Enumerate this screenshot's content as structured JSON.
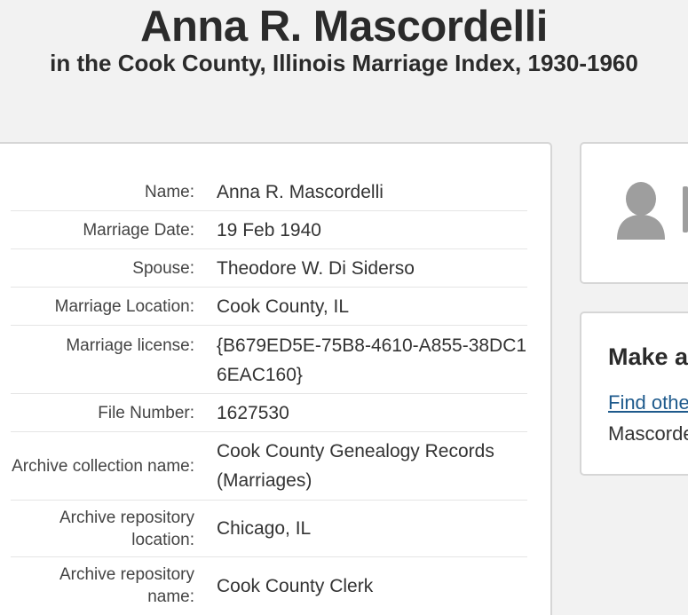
{
  "header": {
    "title": "Anna R. Mascordelli",
    "subtitle": "in the Cook County, Illinois Marriage Index, 1930-1960"
  },
  "record": {
    "rows": [
      {
        "label": "Name:",
        "value": "Anna R. Mascordelli"
      },
      {
        "label": "Marriage Date:",
        "value": "19 Feb 1940"
      },
      {
        "label": "Spouse:",
        "value": "Theodore W. Di Siderso"
      },
      {
        "label": "Marriage Location:",
        "value": "Cook County, IL"
      },
      {
        "label": "Marriage license:",
        "value": "{B679ED5E-75B8-4610-A855-38DC16EAC160}"
      },
      {
        "label": "File Number:",
        "value": "1627530"
      },
      {
        "label": "Archive collection name:",
        "value": "Cook County Genealogy Records (Marriages)"
      },
      {
        "label": "Archive repository location:",
        "value": "Chicago, IL"
      },
      {
        "label": "Archive repository name:",
        "value": "Cook County Clerk"
      }
    ]
  },
  "sidebar": {
    "avatar_icon": "person-silhouette-icon",
    "action_heading": "Make a",
    "action_link": "Find othe",
    "action_text": "Mascorde"
  },
  "colors": {
    "background": "#f2f2f2",
    "card": "#ffffff",
    "link": "#1e5a8c",
    "avatar": "#9e9e9e"
  }
}
